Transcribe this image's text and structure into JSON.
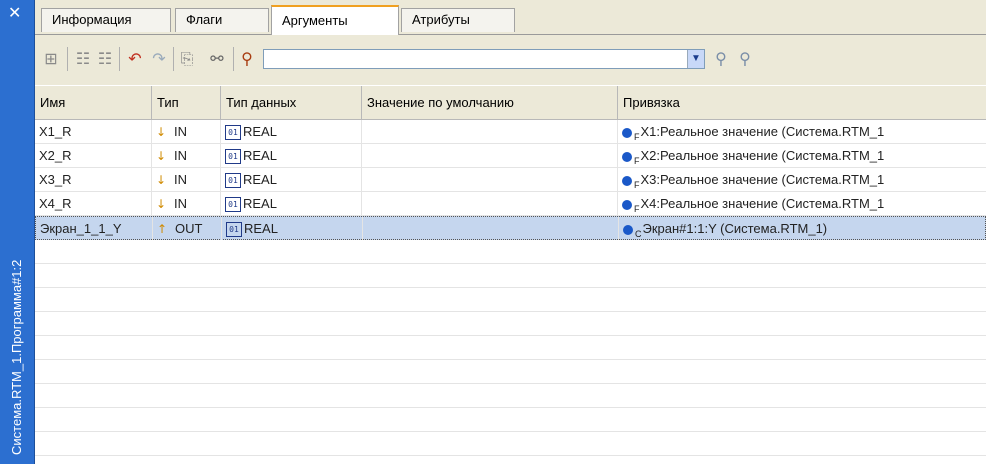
{
  "side_panel": {
    "title": "Система.RTM_1.Программа#1:2",
    "close_icon": "close-icon"
  },
  "tabs": [
    {
      "label": "Информация"
    },
    {
      "label": "Флаги"
    },
    {
      "label": "Аргументы",
      "active": true
    },
    {
      "label": "Атрибуты"
    }
  ],
  "toolbar": {
    "search_value": ""
  },
  "grid": {
    "columns": [
      "Имя",
      "Тип",
      "Тип данных",
      "Значение по умолчанию",
      "Привязка"
    ],
    "rows": [
      {
        "name": "X1_R",
        "type": "IN",
        "data_type": "REAL",
        "default": "",
        "bind_sub": "F",
        "binding": "X1:Реальное значение (Система.RTM_1"
      },
      {
        "name": "X2_R",
        "type": "IN",
        "data_type": "REAL",
        "default": "",
        "bind_sub": "F",
        "binding": "X2:Реальное значение (Система.RTM_1"
      },
      {
        "name": "X3_R",
        "type": "IN",
        "data_type": "REAL",
        "default": "",
        "bind_sub": "F",
        "binding": "X3:Реальное значение (Система.RTM_1"
      },
      {
        "name": "X4_R",
        "type": "IN",
        "data_type": "REAL",
        "default": "",
        "bind_sub": "F",
        "binding": "X4:Реальное значение (Система.RTM_1"
      },
      {
        "name": "Экран_1_1_Y",
        "type": "OUT",
        "data_type": "REAL",
        "default": "",
        "bind_sub": "C",
        "binding": "Экран#1:1:Y (Система.RTM_1)",
        "selected": true
      }
    ]
  },
  "colors": {
    "side_panel": "#2c6fd0",
    "selection": "#c5d6ee",
    "active_tab_accent": "#f0a020"
  }
}
